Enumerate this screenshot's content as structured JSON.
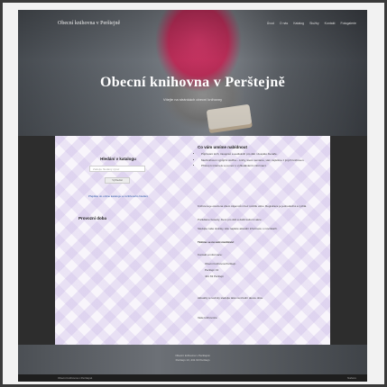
{
  "header": {
    "site_title": "Obecní knihovna v Perštejně",
    "nav": [
      "Úvod",
      "O nás",
      "Katalog",
      "Služby",
      "Kontakt",
      "Fotogalerie"
    ]
  },
  "hero": {
    "title": "Obecní knihovna v Perštejně",
    "subtitle": "Vítejte na stránkách obecní knihovny"
  },
  "sidebar": {
    "search_title": "Hledání v katalogu",
    "search_placeholder": "Zadejte hledaný výraz",
    "search_button": "Vyhledat",
    "catalog_link": "Přejděte do online katalogu a rozšířeného hledání",
    "hours_title": "Provozní doba"
  },
  "main": {
    "help_title": "Co vám umíme nabídnout",
    "help_items": [
      "Půjčování knih, časopisů a audioknih pro děti i dospělé čtenáře.",
      "Meziknihovní výpůjční služba – knihy, které nemáme, vám zajistíme z jiných knihoven.",
      "Přístup k internetu a pomoc s vyhledáváním informací."
    ],
    "paragraphs": [
      "Knihovna je otevřena všem zájemcům bez rozdílu věku. Registrace je jednoduchá a rychlá.",
      "Pořádáme besedy, čtení pro děti a další kulturní akce.",
      "Sledujte naše stránky, kde najdete aktuální informace o novinkách."
    ],
    "bold_paragraph": "Těšíme se na vaši návštěvu!",
    "contact_title": "Kontakt a informace:",
    "contact_items": [
      "Obecní knihovna Perštejn",
      "Perštejn 13",
      "431 63 Perštejn"
    ],
    "outro": "Aktuality a novinky sledujte také na úřední desce obce.",
    "signature": "Vaše knihovnice"
  },
  "footer": {
    "line1": "Obecní knihovna v Perštejně",
    "line2": "Perštejn 13, 431 63 Perštejn"
  },
  "bottom_bar": {
    "left": "Obecní knihovna v Perštejně",
    "right": "Nahoru"
  }
}
